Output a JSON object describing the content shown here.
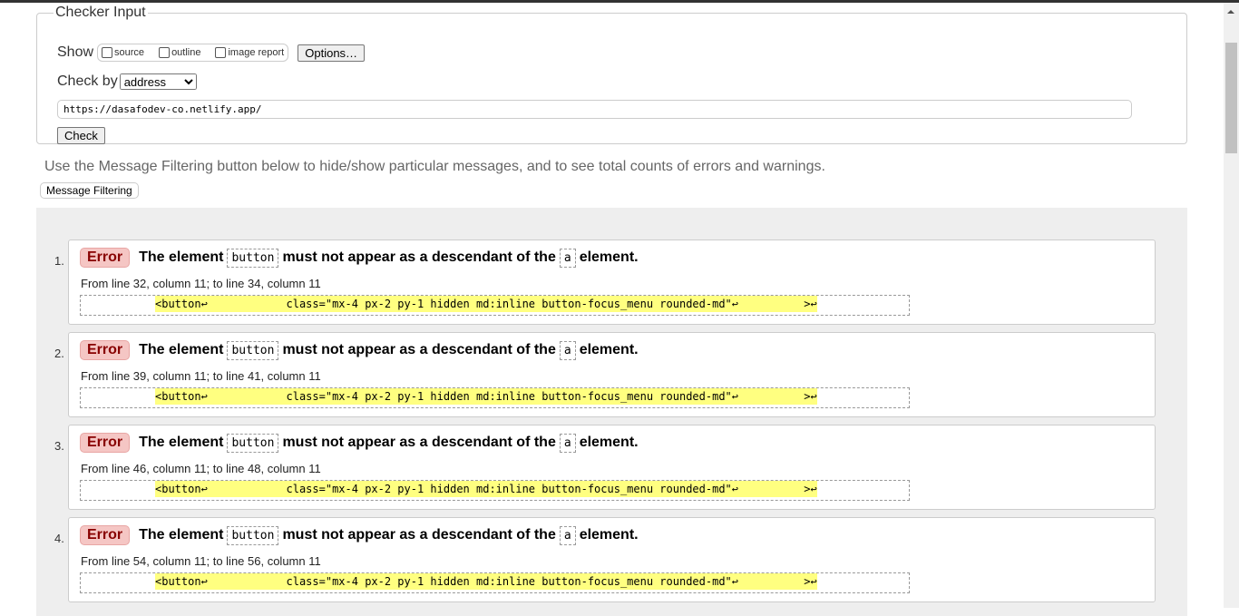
{
  "checker": {
    "legend": "Checker Input",
    "show_label": "Show",
    "show_options": [
      "source",
      "outline",
      "image report"
    ],
    "options_button": "Options…",
    "check_by_label": "Check by",
    "check_by_value": "address",
    "url_value": "https://dasafodev-co.netlify.app/",
    "check_button": "Check"
  },
  "hint": "Use the Message Filtering button below to hide/show particular messages, and to see total counts of errors and warnings.",
  "message_filtering_button": "Message Filtering",
  "messages": [
    {
      "num": "1.",
      "type": "Error",
      "t1": "The element",
      "el1": "button",
      "t2": "must not appear as a descendant of the",
      "el2": "a",
      "t3": "element.",
      "location": "From line 32, column 11; to line 34, column 11",
      "extract": "<button↩            class=\"mx-4 px-2 py-1 hidden md:inline button-focus_menu rounded-md\"↩          >↩"
    },
    {
      "num": "2.",
      "type": "Error",
      "t1": "The element",
      "el1": "button",
      "t2": "must not appear as a descendant of the",
      "el2": "a",
      "t3": "element.",
      "location": "From line 39, column 11; to line 41, column 11",
      "extract": "<button↩            class=\"mx-4 px-2 py-1 hidden md:inline button-focus_menu rounded-md\"↩          >↩"
    },
    {
      "num": "3.",
      "type": "Error",
      "t1": "The element",
      "el1": "button",
      "t2": "must not appear as a descendant of the",
      "el2": "a",
      "t3": "element.",
      "location": "From line 46, column 11; to line 48, column 11",
      "extract": "<button↩            class=\"mx-4 px-2 py-1 hidden md:inline button-focus_menu rounded-md\"↩          >↩"
    },
    {
      "num": "4.",
      "type": "Error",
      "t1": "The element",
      "el1": "button",
      "t2": "must not appear as a descendant of the",
      "el2": "a",
      "t3": "element.",
      "location": "From line 54, column 11; to line 56, column 11",
      "extract": "<button↩            class=\"mx-4 px-2 py-1 hidden md:inline button-focus_menu rounded-md\"↩          >↩"
    }
  ]
}
